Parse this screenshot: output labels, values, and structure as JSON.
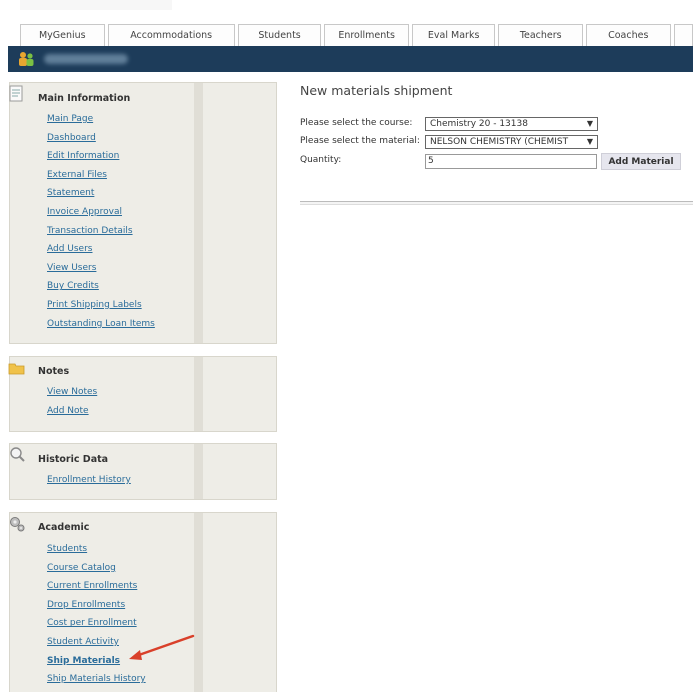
{
  "tabs": [
    "MyGenius",
    "Accommodations",
    "Students",
    "Enrollments",
    "Eval Marks",
    "Teachers",
    "Coaches",
    ""
  ],
  "header": {
    "icon": "school-people-icon",
    "bar_color": "#1d3c5a"
  },
  "sidebar": {
    "main": {
      "title": "Main Information",
      "icon": "document-icon",
      "items": [
        "Main Page",
        "Dashboard",
        "Edit Information",
        "External Files",
        "Statement",
        "Invoice Approval",
        "Transaction Details",
        "Add Users",
        "View Users",
        "Buy Credits",
        "Print Shipping Labels",
        "Outstanding Loan Items"
      ]
    },
    "notes": {
      "title": "Notes",
      "icon": "folder-icon",
      "items": [
        "View Notes",
        "Add Note"
      ]
    },
    "historic": {
      "title": "Historic Data",
      "icon": "magnifier-icon",
      "items": [
        "Enrollment History"
      ]
    },
    "academic": {
      "title": "Academic",
      "icon": "gears-icon",
      "items": [
        "Students",
        "Course Catalog",
        "Current Enrollments",
        "Drop Enrollments",
        "Cost per Enrollment",
        "Student Activity",
        "Ship Materials",
        "Ship Materials History"
      ],
      "active_item": "Ship Materials"
    }
  },
  "main": {
    "title": "New materials shipment",
    "course_label": "Please select the course:",
    "course_value": "Chemistry 20 - 13138",
    "material_label": "Please select the material:",
    "material_value": "NELSON CHEMISTRY (CHEMIST",
    "quantity_label": "Quantity:",
    "quantity_value": "5",
    "add_button": "Add Material"
  },
  "colors": {
    "link": "#2a6c9a",
    "panel_bg": "#eeede7",
    "annotation_arrow": "#d9402a"
  }
}
